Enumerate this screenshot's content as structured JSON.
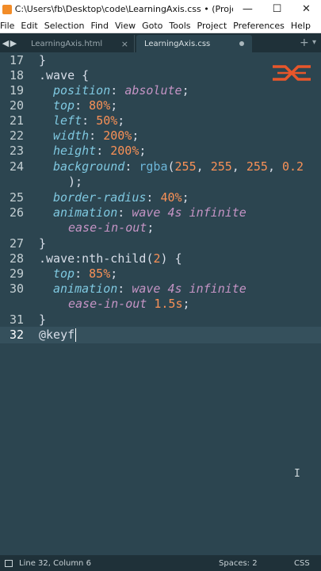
{
  "window": {
    "title": "C:\\Users\\fb\\Desktop\\code\\LearningAxis.css • (Project) - Subl...",
    "minimize": "—",
    "maximize": "☐",
    "close": "✕"
  },
  "menu": [
    "File",
    "Edit",
    "Selection",
    "Find",
    "View",
    "Goto",
    "Tools",
    "Project",
    "Preferences",
    "Help"
  ],
  "tabs": {
    "prev_arrow": "◀",
    "next_arrow": "▶",
    "tab1_label": "LearningAxis.html",
    "tab1_close": "×",
    "tab2_label": "LearningAxis.css",
    "plus": "+",
    "chevron": "▾"
  },
  "gutter": [
    "17",
    "18",
    "19",
    "20",
    "21",
    "22",
    "23",
    "24",
    "25",
    "26",
    "27",
    "28",
    "29",
    "30",
    "31",
    "32"
  ],
  "code": {
    "l17": "}",
    "l18_sel": ".wave",
    "l18_brace": " {",
    "l19_prop": "position",
    "l19_val": "absolute",
    "l20_prop": "top",
    "l20_num": "80%",
    "l21_prop": "left",
    "l21_num": "50%",
    "l22_prop": "width",
    "l22_num": "200%",
    "l23_prop": "height",
    "l23_num": "200%",
    "l24_prop": "background",
    "l24_fn": "rgba",
    "l24_a": "255",
    "l24_b": "255",
    "l24_c": "255",
    "l24_d": "0.2",
    "l24_cont": ");",
    "l25_prop": "border-radius",
    "l25_num": "40%",
    "l26_prop": "animation",
    "l26_val": "wave 4s infinite",
    "l26_cont": "ease-in-out",
    "l27": "}",
    "l28_sel": ".wave:nth-child(",
    "l28_num": "2",
    "l28_end": ") {",
    "l29_prop": "top",
    "l29_num": "85%",
    "l30_prop": "animation",
    "l30_val": "wave 4s infinite",
    "l30_cont_val": "ease-in-out",
    "l30_cont_num": "1.5s",
    "l31": "}",
    "l32": "@keyf"
  },
  "status": {
    "position": "Line 32, Column 6",
    "spaces": "Spaces: 2",
    "syntax": "CSS"
  },
  "colors": {
    "editor_bg": "#2c4550",
    "property": "#7fc8e0",
    "value": "#c594c5",
    "number": "#f99157",
    "logo": "#e8562a"
  },
  "icons": {
    "app": "sublime-text-icon",
    "logo": "learning-axis-logo"
  }
}
